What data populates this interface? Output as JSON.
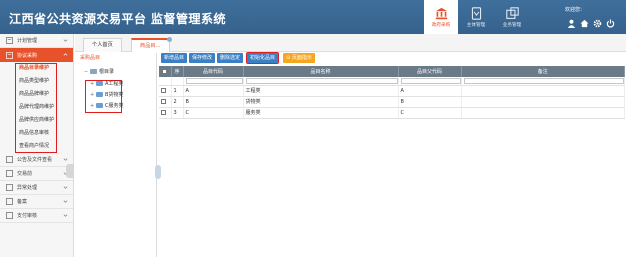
{
  "header": {
    "title": "江西省公共资源交易平台 监督管理系统",
    "nav": [
      {
        "label": "政府采购",
        "icon": "building-icon",
        "active": true
      },
      {
        "label": "主体管理",
        "icon": "entity-book-icon",
        "active": false
      },
      {
        "label": "业务管理",
        "icon": "business-window-icon",
        "active": false
      }
    ],
    "user_greeting": "欢迎您：",
    "icons": [
      "user-icon",
      "home-icon",
      "gear-icon",
      "power-icon"
    ]
  },
  "sidebar": {
    "items_top": [
      {
        "label": "计划管理",
        "icon": "plan-icon"
      },
      {
        "label": "协议采购",
        "icon": "agreement-icon",
        "open": true
      }
    ],
    "sub_items": [
      "商品目录维护",
      "商品类型维护",
      "商品品牌维护",
      "品牌代理商维护",
      "品牌供应商维护",
      "商品信息审核",
      "查看商户情况"
    ],
    "active_sub": 0,
    "items_bottom": [
      {
        "label": "公告及文件查看",
        "icon": "notice-icon"
      },
      {
        "label": "交易前",
        "icon": "pre-trade-icon"
      },
      {
        "label": "异常处理",
        "icon": "exception-icon"
      },
      {
        "label": "备案",
        "icon": "record-icon"
      },
      {
        "label": "支付审核",
        "icon": "payment-icon"
      }
    ]
  },
  "tabs": [
    {
      "label": "个人首页"
    },
    {
      "label": "商品目..."
    }
  ],
  "tree": {
    "header": "采购品目",
    "root": "根目录",
    "nodes": [
      "A工程类",
      "B货物类",
      "C服务类"
    ]
  },
  "toolbar": {
    "buttons": [
      "新增品目",
      "保存修改",
      "删除选定",
      "初始化品目"
    ],
    "help": "⊙ 页面指示"
  },
  "grid": {
    "columns": [
      "序",
      "品目代码",
      "品目名称",
      "品目父代码",
      "备注"
    ],
    "rows": [
      {
        "no": "1",
        "code": "A",
        "name": "工程类",
        "parent": "A",
        "note": ""
      },
      {
        "no": "2",
        "code": "B",
        "name": "货物类",
        "parent": "B",
        "note": ""
      },
      {
        "no": "3",
        "code": "C",
        "name": "服务类",
        "parent": "C",
        "note": ""
      }
    ]
  },
  "colors": {
    "accent": "#e8522a",
    "header_bg": "#3f6f9b",
    "button": "#3b7fc4",
    "grid_header": "#6b7a87"
  }
}
